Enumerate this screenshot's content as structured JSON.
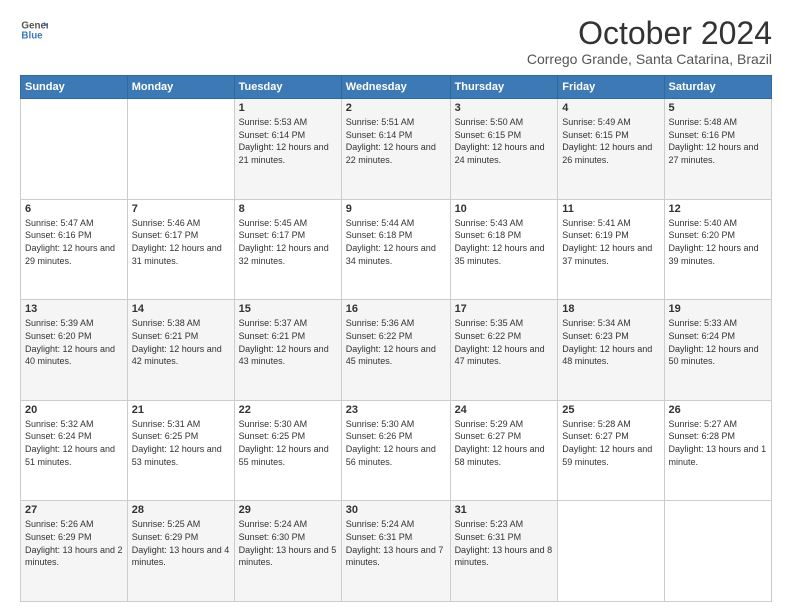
{
  "header": {
    "logo_line1": "General",
    "logo_line2": "Blue",
    "title": "October 2024",
    "subtitle": "Corrego Grande, Santa Catarina, Brazil"
  },
  "calendar": {
    "days_of_week": [
      "Sunday",
      "Monday",
      "Tuesday",
      "Wednesday",
      "Thursday",
      "Friday",
      "Saturday"
    ],
    "weeks": [
      [
        {
          "day": "",
          "sunrise": "",
          "sunset": "",
          "daylight": ""
        },
        {
          "day": "",
          "sunrise": "",
          "sunset": "",
          "daylight": ""
        },
        {
          "day": "1",
          "sunrise": "Sunrise: 5:53 AM",
          "sunset": "Sunset: 6:14 PM",
          "daylight": "Daylight: 12 hours and 21 minutes."
        },
        {
          "day": "2",
          "sunrise": "Sunrise: 5:51 AM",
          "sunset": "Sunset: 6:14 PM",
          "daylight": "Daylight: 12 hours and 22 minutes."
        },
        {
          "day": "3",
          "sunrise": "Sunrise: 5:50 AM",
          "sunset": "Sunset: 6:15 PM",
          "daylight": "Daylight: 12 hours and 24 minutes."
        },
        {
          "day": "4",
          "sunrise": "Sunrise: 5:49 AM",
          "sunset": "Sunset: 6:15 PM",
          "daylight": "Daylight: 12 hours and 26 minutes."
        },
        {
          "day": "5",
          "sunrise": "Sunrise: 5:48 AM",
          "sunset": "Sunset: 6:16 PM",
          "daylight": "Daylight: 12 hours and 27 minutes."
        }
      ],
      [
        {
          "day": "6",
          "sunrise": "Sunrise: 5:47 AM",
          "sunset": "Sunset: 6:16 PM",
          "daylight": "Daylight: 12 hours and 29 minutes."
        },
        {
          "day": "7",
          "sunrise": "Sunrise: 5:46 AM",
          "sunset": "Sunset: 6:17 PM",
          "daylight": "Daylight: 12 hours and 31 minutes."
        },
        {
          "day": "8",
          "sunrise": "Sunrise: 5:45 AM",
          "sunset": "Sunset: 6:17 PM",
          "daylight": "Daylight: 12 hours and 32 minutes."
        },
        {
          "day": "9",
          "sunrise": "Sunrise: 5:44 AM",
          "sunset": "Sunset: 6:18 PM",
          "daylight": "Daylight: 12 hours and 34 minutes."
        },
        {
          "day": "10",
          "sunrise": "Sunrise: 5:43 AM",
          "sunset": "Sunset: 6:18 PM",
          "daylight": "Daylight: 12 hours and 35 minutes."
        },
        {
          "day": "11",
          "sunrise": "Sunrise: 5:41 AM",
          "sunset": "Sunset: 6:19 PM",
          "daylight": "Daylight: 12 hours and 37 minutes."
        },
        {
          "day": "12",
          "sunrise": "Sunrise: 5:40 AM",
          "sunset": "Sunset: 6:20 PM",
          "daylight": "Daylight: 12 hours and 39 minutes."
        }
      ],
      [
        {
          "day": "13",
          "sunrise": "Sunrise: 5:39 AM",
          "sunset": "Sunset: 6:20 PM",
          "daylight": "Daylight: 12 hours and 40 minutes."
        },
        {
          "day": "14",
          "sunrise": "Sunrise: 5:38 AM",
          "sunset": "Sunset: 6:21 PM",
          "daylight": "Daylight: 12 hours and 42 minutes."
        },
        {
          "day": "15",
          "sunrise": "Sunrise: 5:37 AM",
          "sunset": "Sunset: 6:21 PM",
          "daylight": "Daylight: 12 hours and 43 minutes."
        },
        {
          "day": "16",
          "sunrise": "Sunrise: 5:36 AM",
          "sunset": "Sunset: 6:22 PM",
          "daylight": "Daylight: 12 hours and 45 minutes."
        },
        {
          "day": "17",
          "sunrise": "Sunrise: 5:35 AM",
          "sunset": "Sunset: 6:22 PM",
          "daylight": "Daylight: 12 hours and 47 minutes."
        },
        {
          "day": "18",
          "sunrise": "Sunrise: 5:34 AM",
          "sunset": "Sunset: 6:23 PM",
          "daylight": "Daylight: 12 hours and 48 minutes."
        },
        {
          "day": "19",
          "sunrise": "Sunrise: 5:33 AM",
          "sunset": "Sunset: 6:24 PM",
          "daylight": "Daylight: 12 hours and 50 minutes."
        }
      ],
      [
        {
          "day": "20",
          "sunrise": "Sunrise: 5:32 AM",
          "sunset": "Sunset: 6:24 PM",
          "daylight": "Daylight: 12 hours and 51 minutes."
        },
        {
          "day": "21",
          "sunrise": "Sunrise: 5:31 AM",
          "sunset": "Sunset: 6:25 PM",
          "daylight": "Daylight: 12 hours and 53 minutes."
        },
        {
          "day": "22",
          "sunrise": "Sunrise: 5:30 AM",
          "sunset": "Sunset: 6:25 PM",
          "daylight": "Daylight: 12 hours and 55 minutes."
        },
        {
          "day": "23",
          "sunrise": "Sunrise: 5:30 AM",
          "sunset": "Sunset: 6:26 PM",
          "daylight": "Daylight: 12 hours and 56 minutes."
        },
        {
          "day": "24",
          "sunrise": "Sunrise: 5:29 AM",
          "sunset": "Sunset: 6:27 PM",
          "daylight": "Daylight: 12 hours and 58 minutes."
        },
        {
          "day": "25",
          "sunrise": "Sunrise: 5:28 AM",
          "sunset": "Sunset: 6:27 PM",
          "daylight": "Daylight: 12 hours and 59 minutes."
        },
        {
          "day": "26",
          "sunrise": "Sunrise: 5:27 AM",
          "sunset": "Sunset: 6:28 PM",
          "daylight": "Daylight: 13 hours and 1 minute."
        }
      ],
      [
        {
          "day": "27",
          "sunrise": "Sunrise: 5:26 AM",
          "sunset": "Sunset: 6:29 PM",
          "daylight": "Daylight: 13 hours and 2 minutes."
        },
        {
          "day": "28",
          "sunrise": "Sunrise: 5:25 AM",
          "sunset": "Sunset: 6:29 PM",
          "daylight": "Daylight: 13 hours and 4 minutes."
        },
        {
          "day": "29",
          "sunrise": "Sunrise: 5:24 AM",
          "sunset": "Sunset: 6:30 PM",
          "daylight": "Daylight: 13 hours and 5 minutes."
        },
        {
          "day": "30",
          "sunrise": "Sunrise: 5:24 AM",
          "sunset": "Sunset: 6:31 PM",
          "daylight": "Daylight: 13 hours and 7 minutes."
        },
        {
          "day": "31",
          "sunrise": "Sunrise: 5:23 AM",
          "sunset": "Sunset: 6:31 PM",
          "daylight": "Daylight: 13 hours and 8 minutes."
        },
        {
          "day": "",
          "sunrise": "",
          "sunset": "",
          "daylight": ""
        },
        {
          "day": "",
          "sunrise": "",
          "sunset": "",
          "daylight": ""
        }
      ]
    ]
  }
}
